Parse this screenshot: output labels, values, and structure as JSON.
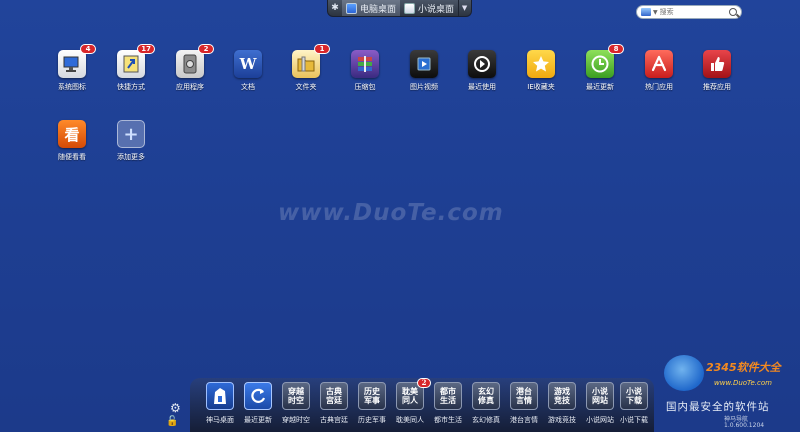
{
  "switcher": {
    "tabs": [
      {
        "label": "电脑桌面"
      },
      {
        "label": "小说桌面"
      }
    ]
  },
  "search": {
    "placeholder": "搜索"
  },
  "desktop_icons": [
    {
      "label": "系统图标",
      "badge": "4"
    },
    {
      "label": "快捷方式",
      "badge": "17"
    },
    {
      "label": "应用程序",
      "badge": "2"
    },
    {
      "label": "文档",
      "glyph": "W"
    },
    {
      "label": "文件夹",
      "badge": "1"
    },
    {
      "label": "压缩包"
    },
    {
      "label": "图片视频"
    },
    {
      "label": "最近使用"
    },
    {
      "label": "IE收藏夹"
    },
    {
      "label": "最近更新",
      "badge": "8"
    },
    {
      "label": "热门应用"
    },
    {
      "label": "推荐应用"
    },
    {
      "label": "随便看看",
      "glyph": "看"
    },
    {
      "label": "添加更多",
      "glyph": "+"
    }
  ],
  "watermark": "www.DuoTe.com",
  "dock": {
    "items": [
      {
        "label": "神马桌面",
        "face": ""
      },
      {
        "label": "最近更新",
        "face": ""
      },
      {
        "label": "穿越时空",
        "face": "穿越\n时空"
      },
      {
        "label": "古典宫廷",
        "face": "古典\n宫廷"
      },
      {
        "label": "历史军事",
        "face": "历史\n军事"
      },
      {
        "label": "耽美同人",
        "face": "耽美\n同人",
        "badge": "2"
      },
      {
        "label": "都市生活",
        "face": "都市\n生活"
      },
      {
        "label": "玄幻修真",
        "face": "玄幻\n修真"
      },
      {
        "label": "港台言情",
        "face": "港台\n言情"
      },
      {
        "label": "游戏竞技",
        "face": "游戏\n竞技"
      },
      {
        "label": "小说网站",
        "face": "小说\n网站"
      },
      {
        "label": "小说下载",
        "face": "小说\n下载"
      }
    ]
  },
  "brand": {
    "title": "2345软件大全",
    "site": "www.DuoTe.com",
    "slogan": "国内最安全的软件站",
    "nav_label": "神马导航",
    "version": "1.0.600.1204"
  }
}
